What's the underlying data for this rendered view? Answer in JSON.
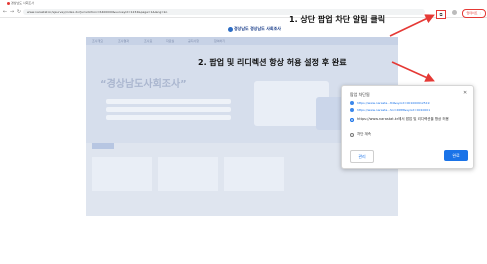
{
  "browser": {
    "tab_title": "경상남도 사회조사",
    "url": "www.narastat.kr/sjsurvey/index.do?jurisdiction=6400000&surveyid=1234&page=1&lang=ko",
    "popup_blocked_icon": "popup-blocked-icon",
    "update_label": "업데이트 ⋮"
  },
  "site": {
    "logo_text": "경상남도 경상남도 사회조사",
    "nav_items": [
      "조사개요",
      "조사결과",
      "조사표",
      "자료실",
      "공지사항",
      "참여하기"
    ],
    "banner_title": "“경상남도사회조사”"
  },
  "annotations": {
    "step1": "1. 상단 팝업 차단 알림 클릭",
    "step2": "2. 팝업 및 리디렉션 항상 허용 설정 후 완료"
  },
  "popup_bubble": {
    "title": "팝업 차단됨",
    "close": "✕",
    "links": [
      "https://www.narasta...84&syoid=001000612519",
      "https://www.narasta...Sn=2688&syoid=0010001"
    ],
    "options": [
      {
        "label": "https://www.narastat.kr에서 팝업 및 리디렉션을 항상 허용",
        "selected": true
      },
      {
        "label": "차단 계속",
        "selected": false
      }
    ],
    "manage_label": "관리",
    "done_label": "완료"
  },
  "colors": {
    "accent": "#1a73e8",
    "annotation_arrow": "#e53935"
  }
}
